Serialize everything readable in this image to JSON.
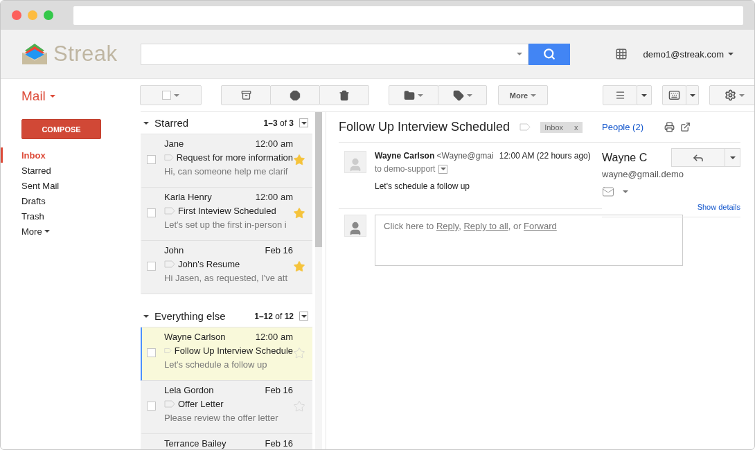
{
  "header": {
    "logo": "Streak",
    "account": "demo1@streak.com"
  },
  "nav": {
    "title": "Mail",
    "compose": "COMPOSE",
    "items": [
      {
        "label": "Inbox",
        "selected": true,
        "kind": "link"
      },
      {
        "label": "Starred",
        "selected": false,
        "kind": "link"
      },
      {
        "label": "Sent Mail",
        "selected": false,
        "kind": "link"
      },
      {
        "label": "Drafts",
        "selected": false,
        "kind": "link"
      },
      {
        "label": "Trash",
        "selected": false,
        "kind": "link"
      },
      {
        "label": "More",
        "selected": false,
        "kind": "menu"
      }
    ]
  },
  "toolbar": {
    "more": "More"
  },
  "sections": [
    {
      "title": "Starred",
      "count": "**1–3** of **3**",
      "threads": [
        {
          "sender": "Jane",
          "time": "12:00 am",
          "subject": "Request for more information",
          "snippet": "Hi, can someone help me clarif",
          "starred": true,
          "selected": false
        },
        {
          "sender": "Karla Henry",
          "time": "12:00 am",
          "subject": "First Inteview Scheduled",
          "snippet": "Let's set up the first in-person i",
          "starred": true,
          "selected": false
        },
        {
          "sender": "John",
          "time": "Feb 16",
          "subject": "John's Resume",
          "snippet": "Hi Jasen, as requested, I've att",
          "starred": true,
          "selected": false
        }
      ]
    },
    {
      "title": "Everything else",
      "count": "**1–12** of **12**",
      "threads": [
        {
          "sender": "Wayne Carlson",
          "time": "12:00 am",
          "subject": "Follow Up Interview Schedule",
          "snippet": "Let's schedule a follow up",
          "starred": false,
          "selected": true
        },
        {
          "sender": "Lela Gordon",
          "time": "Feb 16",
          "subject": "Offer Letter",
          "snippet": "Please review the offer letter",
          "starred": false,
          "selected": false
        },
        {
          "sender": "Terrance Bailey",
          "time": "Feb 16",
          "selected": false
        }
      ]
    }
  ],
  "conversation": {
    "subject": "Follow Up Interview Scheduled",
    "label": "Inbox",
    "label_remove": "x",
    "message": {
      "sender": "Wayne Carlson",
      "address": "<Wayne@gmai",
      "time": "12:00 AM (22 hours ago)",
      "to": "to demo-support",
      "body": "Let's schedule a follow up"
    },
    "reply_prompt": [
      {
        "text": "Click here to ",
        "kind": "plain"
      },
      {
        "text": "Reply",
        "kind": "link"
      },
      {
        "text": ", ",
        "kind": "plain"
      },
      {
        "text": "Reply to all",
        "kind": "link"
      },
      {
        "text": ", or ",
        "kind": "plain"
      },
      {
        "text": "Forward",
        "kind": "link"
      }
    ]
  },
  "people": {
    "title": "People (2)",
    "name": "Wayne C",
    "email": "wayne@gmail.demo",
    "details": "Show details"
  }
}
